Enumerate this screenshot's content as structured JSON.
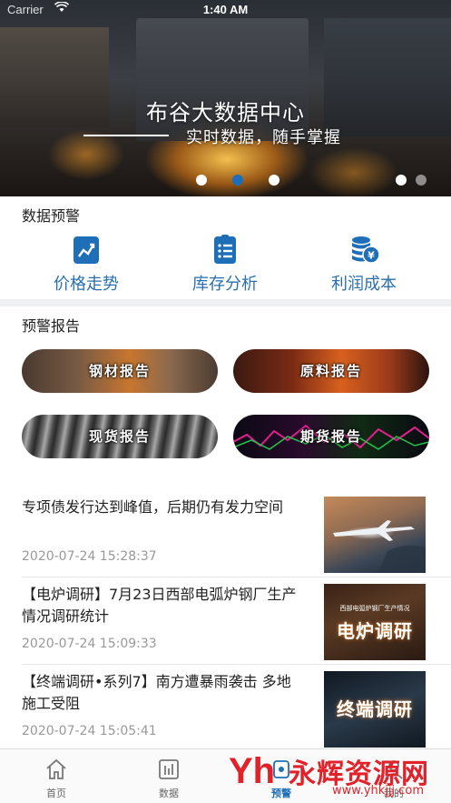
{
  "status_bar": {
    "carrier": "Carrier",
    "wifi_icon": "wifi-icon",
    "time": "1:40 AM"
  },
  "banner": {
    "title": "布谷大数据中心",
    "subtitle": "实时数据，随手掌握",
    "slides": 5,
    "active_slide": 2
  },
  "data_warning": {
    "title": "数据预警",
    "items": [
      {
        "label": "价格走势",
        "icon": "trend-chart-icon"
      },
      {
        "label": "库存分析",
        "icon": "list-document-icon"
      },
      {
        "label": "利润成本",
        "icon": "coins-yuan-icon"
      }
    ]
  },
  "reports": {
    "title": "预警报告",
    "items": [
      {
        "label": "钢材报告"
      },
      {
        "label": "原料报告"
      },
      {
        "label": "现货报告"
      },
      {
        "label": "期货报告"
      }
    ]
  },
  "news": [
    {
      "title": "专项债发行达到峰值，后期仍有发力空间",
      "time": "2020-07-24 15:28:37"
    },
    {
      "title": "【电炉调研】7月23日西部电弧炉钢厂生产情况调研统计",
      "time": "2020-07-24 15:09:33",
      "thumb_title": "电炉调研",
      "thumb_caption": "西部电弧炉钢厂生产情况"
    },
    {
      "title": "【终端调研•系列7】南方遭暴雨袭击  多地施工受阻",
      "time": "2020-07-24 15:05:41",
      "thumb_title": "终端调研"
    }
  ],
  "tabbar": {
    "items": [
      {
        "label": "首页",
        "icon": "home-icon"
      },
      {
        "label": "数据",
        "icon": "bar-chart-icon"
      },
      {
        "label": "预警",
        "icon": "alert-icon"
      },
      {
        "label": "我的",
        "icon": "user-icon"
      }
    ],
    "active": 2
  },
  "watermark": {
    "name": "永辉资源网",
    "url": "www.yhkjjj.com"
  },
  "colors": {
    "accent": "#1f6fb8",
    "text_blue": "#2a6fae",
    "time_gray": "#999999"
  }
}
